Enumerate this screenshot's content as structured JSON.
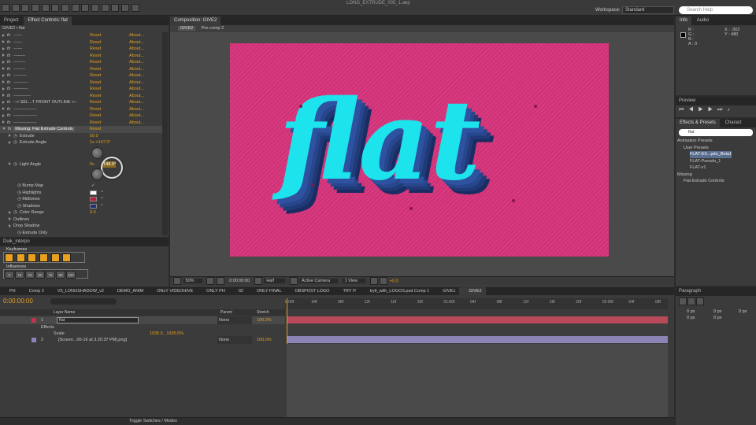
{
  "app": {
    "title": "LONG_EXTRUDE_005_1.aep",
    "workspace_label": "Workspace:",
    "workspace_value": "Standard",
    "search_help": "Search Help"
  },
  "effect_controls": {
    "tab_project": "Project",
    "tab_effect": "Effect Controls: flat",
    "breadcrumb": "GIVE2 • flat",
    "reset": "Reset",
    "about": "About...",
    "rows": [
      "------",
      "------",
      "------",
      "--------",
      "--------",
      "--------",
      "---------",
      "----------",
      "----------",
      "------------",
      "--> SEL...T FRONT OUTLINE <--",
      "----------------",
      "----------------",
      "----------------"
    ],
    "missing": "Missing: Flat Extrude Controls",
    "extrude_label": "Extrude",
    "extrude_value": "50.0",
    "extrude_angle_label": "Extrude Angle",
    "extrude_angle_value": "1x +147.0°",
    "light_angle_label": "Light Angle",
    "light_angle_value_a": "0x",
    "light_angle_value_b": "+148.0°",
    "bump_map": "Bump Map",
    "highlights": "Highlights",
    "midtones": "Midtones",
    "shadows": "Shadows",
    "color_range_label": "Color Range",
    "color_range_value": "0.0",
    "outlines": "Outlines",
    "drop_shadow": "Drop Shadow",
    "extrude_only": "Extrude Only",
    "colors": {
      "highlights": "#ffffff",
      "midtones": "#c41840",
      "shadows": "#203070"
    }
  },
  "duik": {
    "title": "Duik_interpo",
    "keyframes": "Keyframes",
    "influences": "Influences",
    "influence_values": [
      "0",
      "10",
      "25",
      "50",
      "75",
      "90",
      "100"
    ]
  },
  "composition": {
    "tab": "Composition: GIVE2",
    "subtab_a": "GIVE2",
    "subtab_b": "Pre-comp 2",
    "text": "flat",
    "bg_color": "#d6337a",
    "text_color": "#1de3ec",
    "shadow_color": "#203a78",
    "zoom": "50%",
    "timecode": "0:00:00:00",
    "resolution": "Half",
    "camera": "Active Camera",
    "view": "1 View",
    "exposure": "+0.0"
  },
  "info": {
    "tab_info": "Info",
    "tab_audio": "Audio",
    "r": "R :",
    "g": "G :",
    "b": "B :",
    "a": "A : 0",
    "x": "X : -302",
    "y": "Y : 480"
  },
  "preview": {
    "title": "Preview"
  },
  "effects_presets": {
    "tab_a": "Effects & Presets",
    "tab_b": "Charact",
    "search": "flat",
    "items": [
      "Animation Presets",
      "User Presets",
      "FLAT-EX...pdo_Beta1",
      "FLAT-Pseudo_1",
      "FLAT-v1",
      "Missing",
      "Flat Extrude Controls"
    ]
  },
  "paragraph": {
    "title": "Paragraph",
    "values": [
      "0 px",
      "0 px",
      "0 px",
      "0 px",
      "0 px"
    ]
  },
  "timeline": {
    "tabs": [
      "PH",
      "Comp 2",
      "V5_LONGSHADOW_v2",
      "DEMO_ANIM",
      "ONLY VIDEOHIVE",
      "ONLY PH",
      "02",
      "ONLY FINAL",
      "OBSPOST LOGO",
      "TRY IT",
      "tryit_with_LOGOS.psd Comp 1",
      "GIVE1",
      "GIVE2"
    ],
    "timecode": "0:00:00:00",
    "col_layer_name": "Layer Name",
    "col_parent": "Parent",
    "col_stretch": "Stretch",
    "layer1_num": "1",
    "layer1_name": "flat",
    "layer1_parent": "None",
    "layer1_stretch": "100.0%",
    "effects": "Effects",
    "scale": "Scale",
    "scale_value": "1935.5 , 1935.5%",
    "layer2_num": "2",
    "layer2_name": "[Screen...06-16 at 3.20.37 PM].png]",
    "layer2_parent": "None",
    "layer2_stretch": "100.0%",
    "toggle": "Toggle Switches / Modes",
    "ruler": [
      "0:00f",
      "04f",
      "08f",
      "12f",
      "16f",
      "20f",
      "01:00f",
      "04f",
      "08f",
      "12f",
      "16f",
      "20f",
      "02:00f",
      "04f",
      "08f"
    ]
  }
}
